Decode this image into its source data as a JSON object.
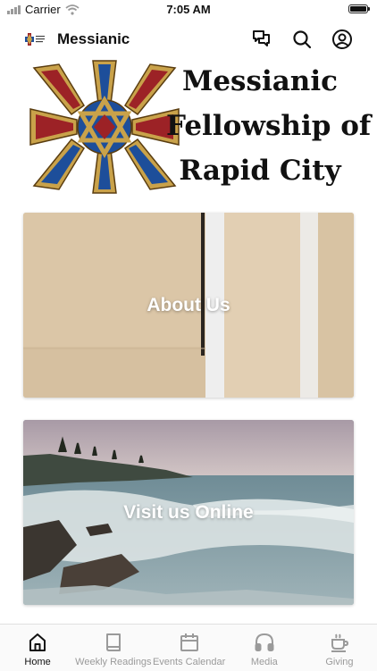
{
  "status_bar": {
    "carrier": "Carrier",
    "time": "7:05 AM"
  },
  "header": {
    "title": "Messianic",
    "icons": [
      "chat-icon",
      "search-icon",
      "account-icon"
    ]
  },
  "banner": {
    "line1": "Messianic",
    "line2": "Fellowship of",
    "line3": "Rapid City"
  },
  "cards": [
    {
      "label": "About Us",
      "image": "beige-wall-photo"
    },
    {
      "label": "Visit us Online",
      "image": "ocean-shore-photo"
    }
  ],
  "tabs": [
    {
      "label": "Home",
      "icon": "home-icon",
      "active": true
    },
    {
      "label": "Weekly Readings",
      "icon": "book-icon",
      "active": false
    },
    {
      "label": "Events Calendar",
      "icon": "calendar-icon",
      "active": false
    },
    {
      "label": "Media",
      "icon": "headphones-icon",
      "active": false
    },
    {
      "label": "Giving",
      "icon": "coffee-icon",
      "active": false
    }
  ],
  "colors": {
    "active_tab": "#111111",
    "inactive_tab": "#9a9a9a",
    "logo_gold": "#c9a24a",
    "logo_blue": "#1d4e9a",
    "logo_red": "#9c2226"
  }
}
